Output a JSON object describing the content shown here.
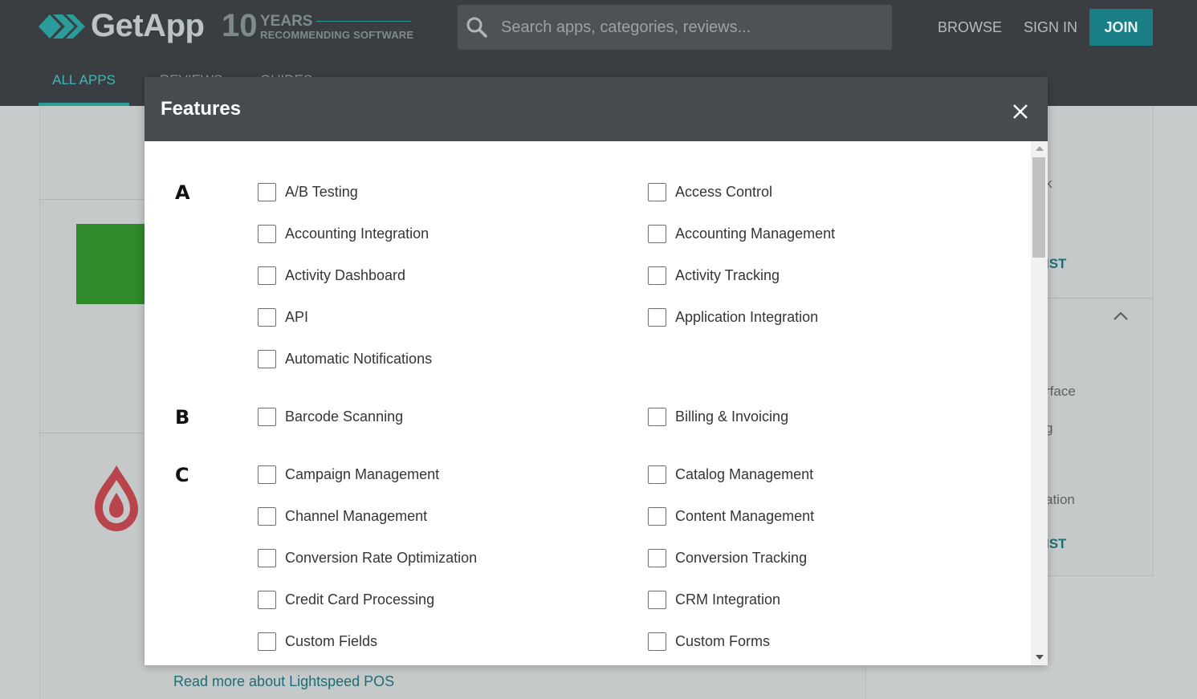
{
  "header": {
    "logo_text": "GetApp",
    "logo_ten": "10",
    "logo_years": "YEARS",
    "logo_tagline": "RECOMMENDING SOFTWARE",
    "search_placeholder": "Search apps, categories, reviews...",
    "nav": {
      "browse": "BROWSE",
      "sign_in": "SIGN IN",
      "join": "JOIN"
    },
    "tabs": [
      "ALL APPS",
      "REVIEWS",
      "GUIDES"
    ]
  },
  "background": {
    "read_more": "Read more about Lightspeed POS",
    "side_fragments": [
      "k",
      "IST",
      "rface",
      "g",
      "ation",
      "IST"
    ]
  },
  "modal": {
    "title": "Features",
    "sections": [
      {
        "letter": "A",
        "features": [
          "A/B Testing",
          "Access Control",
          "Accounting Integration",
          "Accounting Management",
          "Activity Dashboard",
          "Activity Tracking",
          "API",
          "Application Integration",
          "Automatic Notifications"
        ]
      },
      {
        "letter": "B",
        "features": [
          "Barcode Scanning",
          "Billing & Invoicing"
        ]
      },
      {
        "letter": "C",
        "features": [
          "Campaign Management",
          "Catalog Management",
          "Channel Management",
          "Content Management",
          "Conversion Rate Optimization",
          "Conversion Tracking",
          "Credit Card Processing",
          "CRM Integration",
          "Custom Fields",
          "Custom Forms"
        ]
      }
    ]
  },
  "colors": {
    "header_bg": "#3a3e42",
    "accent_teal": "#2a9c9a",
    "join_bg": "#1a7e86",
    "modal_header_bg": "#474c50"
  }
}
